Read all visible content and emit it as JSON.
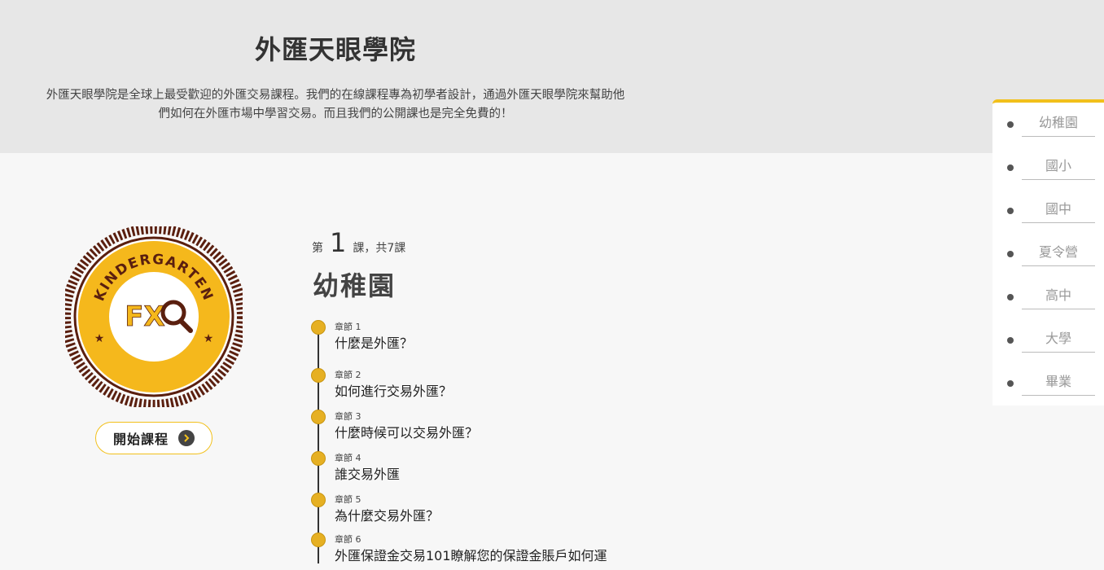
{
  "header": {
    "title": "外匯天眼學院",
    "description": "外匯天眼學院是全球上最受歡迎的外匯交易課程。我們的在線課程專為初學者設計，通過外匯天眼學院來幫助他們如何在外匯市場中學習交易。而且我們的公開課也是完全免費的！"
  },
  "badge": {
    "top_text": "KINDERGARTEN",
    "logo_text": "FX",
    "icon": "magnifier-icon",
    "colors": {
      "gold": "#f5b81c",
      "ring": "#5a1f0f"
    }
  },
  "start_button": {
    "label": "開始課程",
    "icon": "arrow-right-circle-icon"
  },
  "lesson": {
    "prefix": "第",
    "number": "1",
    "suffix": "課，共7課",
    "title": "幼稚園"
  },
  "chapters": [
    {
      "label": "章節 1",
      "title": "什麼是外匯？"
    },
    {
      "label": "章節 2",
      "title": "如何進行交易外匯？"
    },
    {
      "label": "章節 3",
      "title": "什麼時候可以交易外匯？"
    },
    {
      "label": "章節 4",
      "title": "誰交易外匯"
    },
    {
      "label": "章節 5",
      "title": "為什麼交易外匯？"
    },
    {
      "label": "章節 6",
      "title": "外匯保證金交易101瞭解您的保證金賬戶如何運"
    }
  ],
  "sidenav": {
    "items": [
      "幼稚園",
      "國小",
      "國中",
      "夏令營",
      "高中",
      "大學",
      "畢業"
    ]
  }
}
